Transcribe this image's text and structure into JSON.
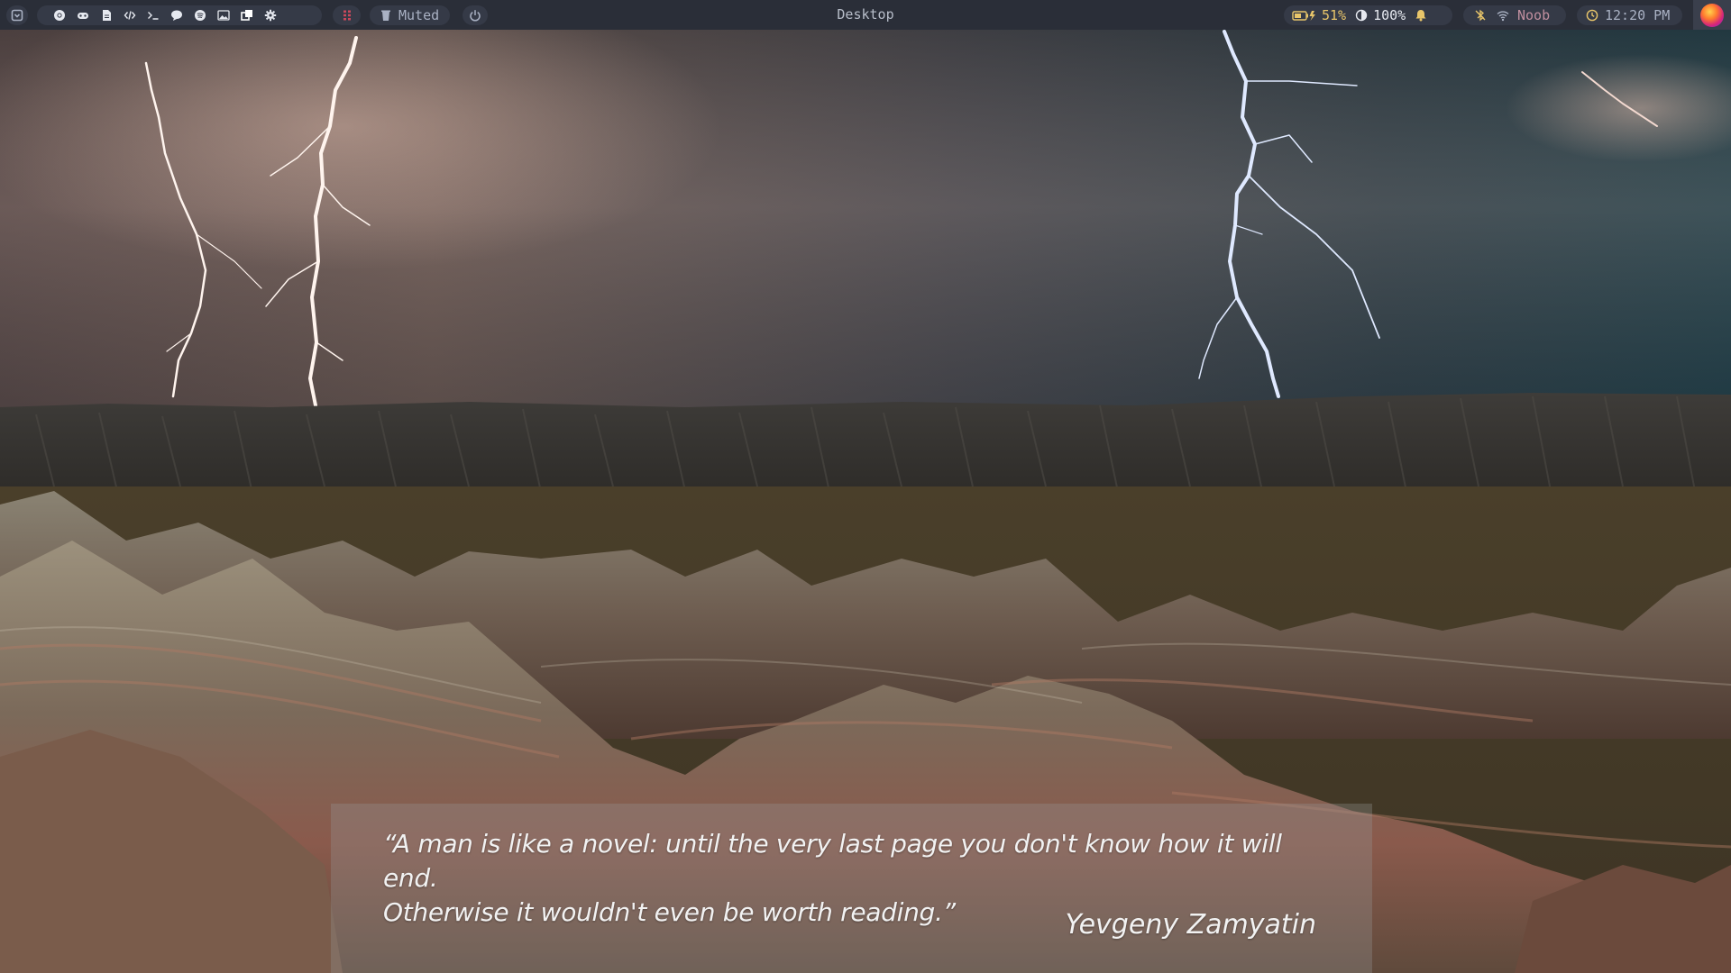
{
  "topbar": {
    "window_title": "Desktop",
    "apps": [
      {
        "icon": "chrome-icon"
      },
      {
        "icon": "gamepad-icon"
      },
      {
        "icon": "file-icon"
      },
      {
        "icon": "code-icon"
      },
      {
        "icon": "terminal-icon"
      },
      {
        "icon": "chat-icon"
      },
      {
        "icon": "spotify-icon"
      },
      {
        "icon": "image-icon"
      },
      {
        "icon": "windows-icon"
      },
      {
        "icon": "gear-icon"
      }
    ],
    "volume": {
      "icon": "trash-icon",
      "label": "Muted"
    },
    "battery": {
      "icon": "battery-charging-icon",
      "value": "51%"
    },
    "brightness": {
      "icon": "brightness-icon",
      "value": "100%"
    },
    "notifications": {
      "icon": "bell-icon"
    },
    "bluetooth": {
      "icon": "bluetooth-off-icon"
    },
    "wifi": {
      "icon": "wifi-icon",
      "ssid": "Noob"
    },
    "clock": {
      "icon": "clock-icon",
      "time": "12:20 PM"
    }
  },
  "quote": {
    "line1": "“A man is like a novel: until the very last page you don't know how it will end.",
    "line2": "Otherwise it wouldn't even be worth reading.”",
    "author": "Yevgeny Zamyatin"
  },
  "colors": {
    "bar_bg": "#2a2e38",
    "pill_bg": "#353a47",
    "text": "#a9b1c3",
    "workspace_accent": "#c9485b"
  }
}
